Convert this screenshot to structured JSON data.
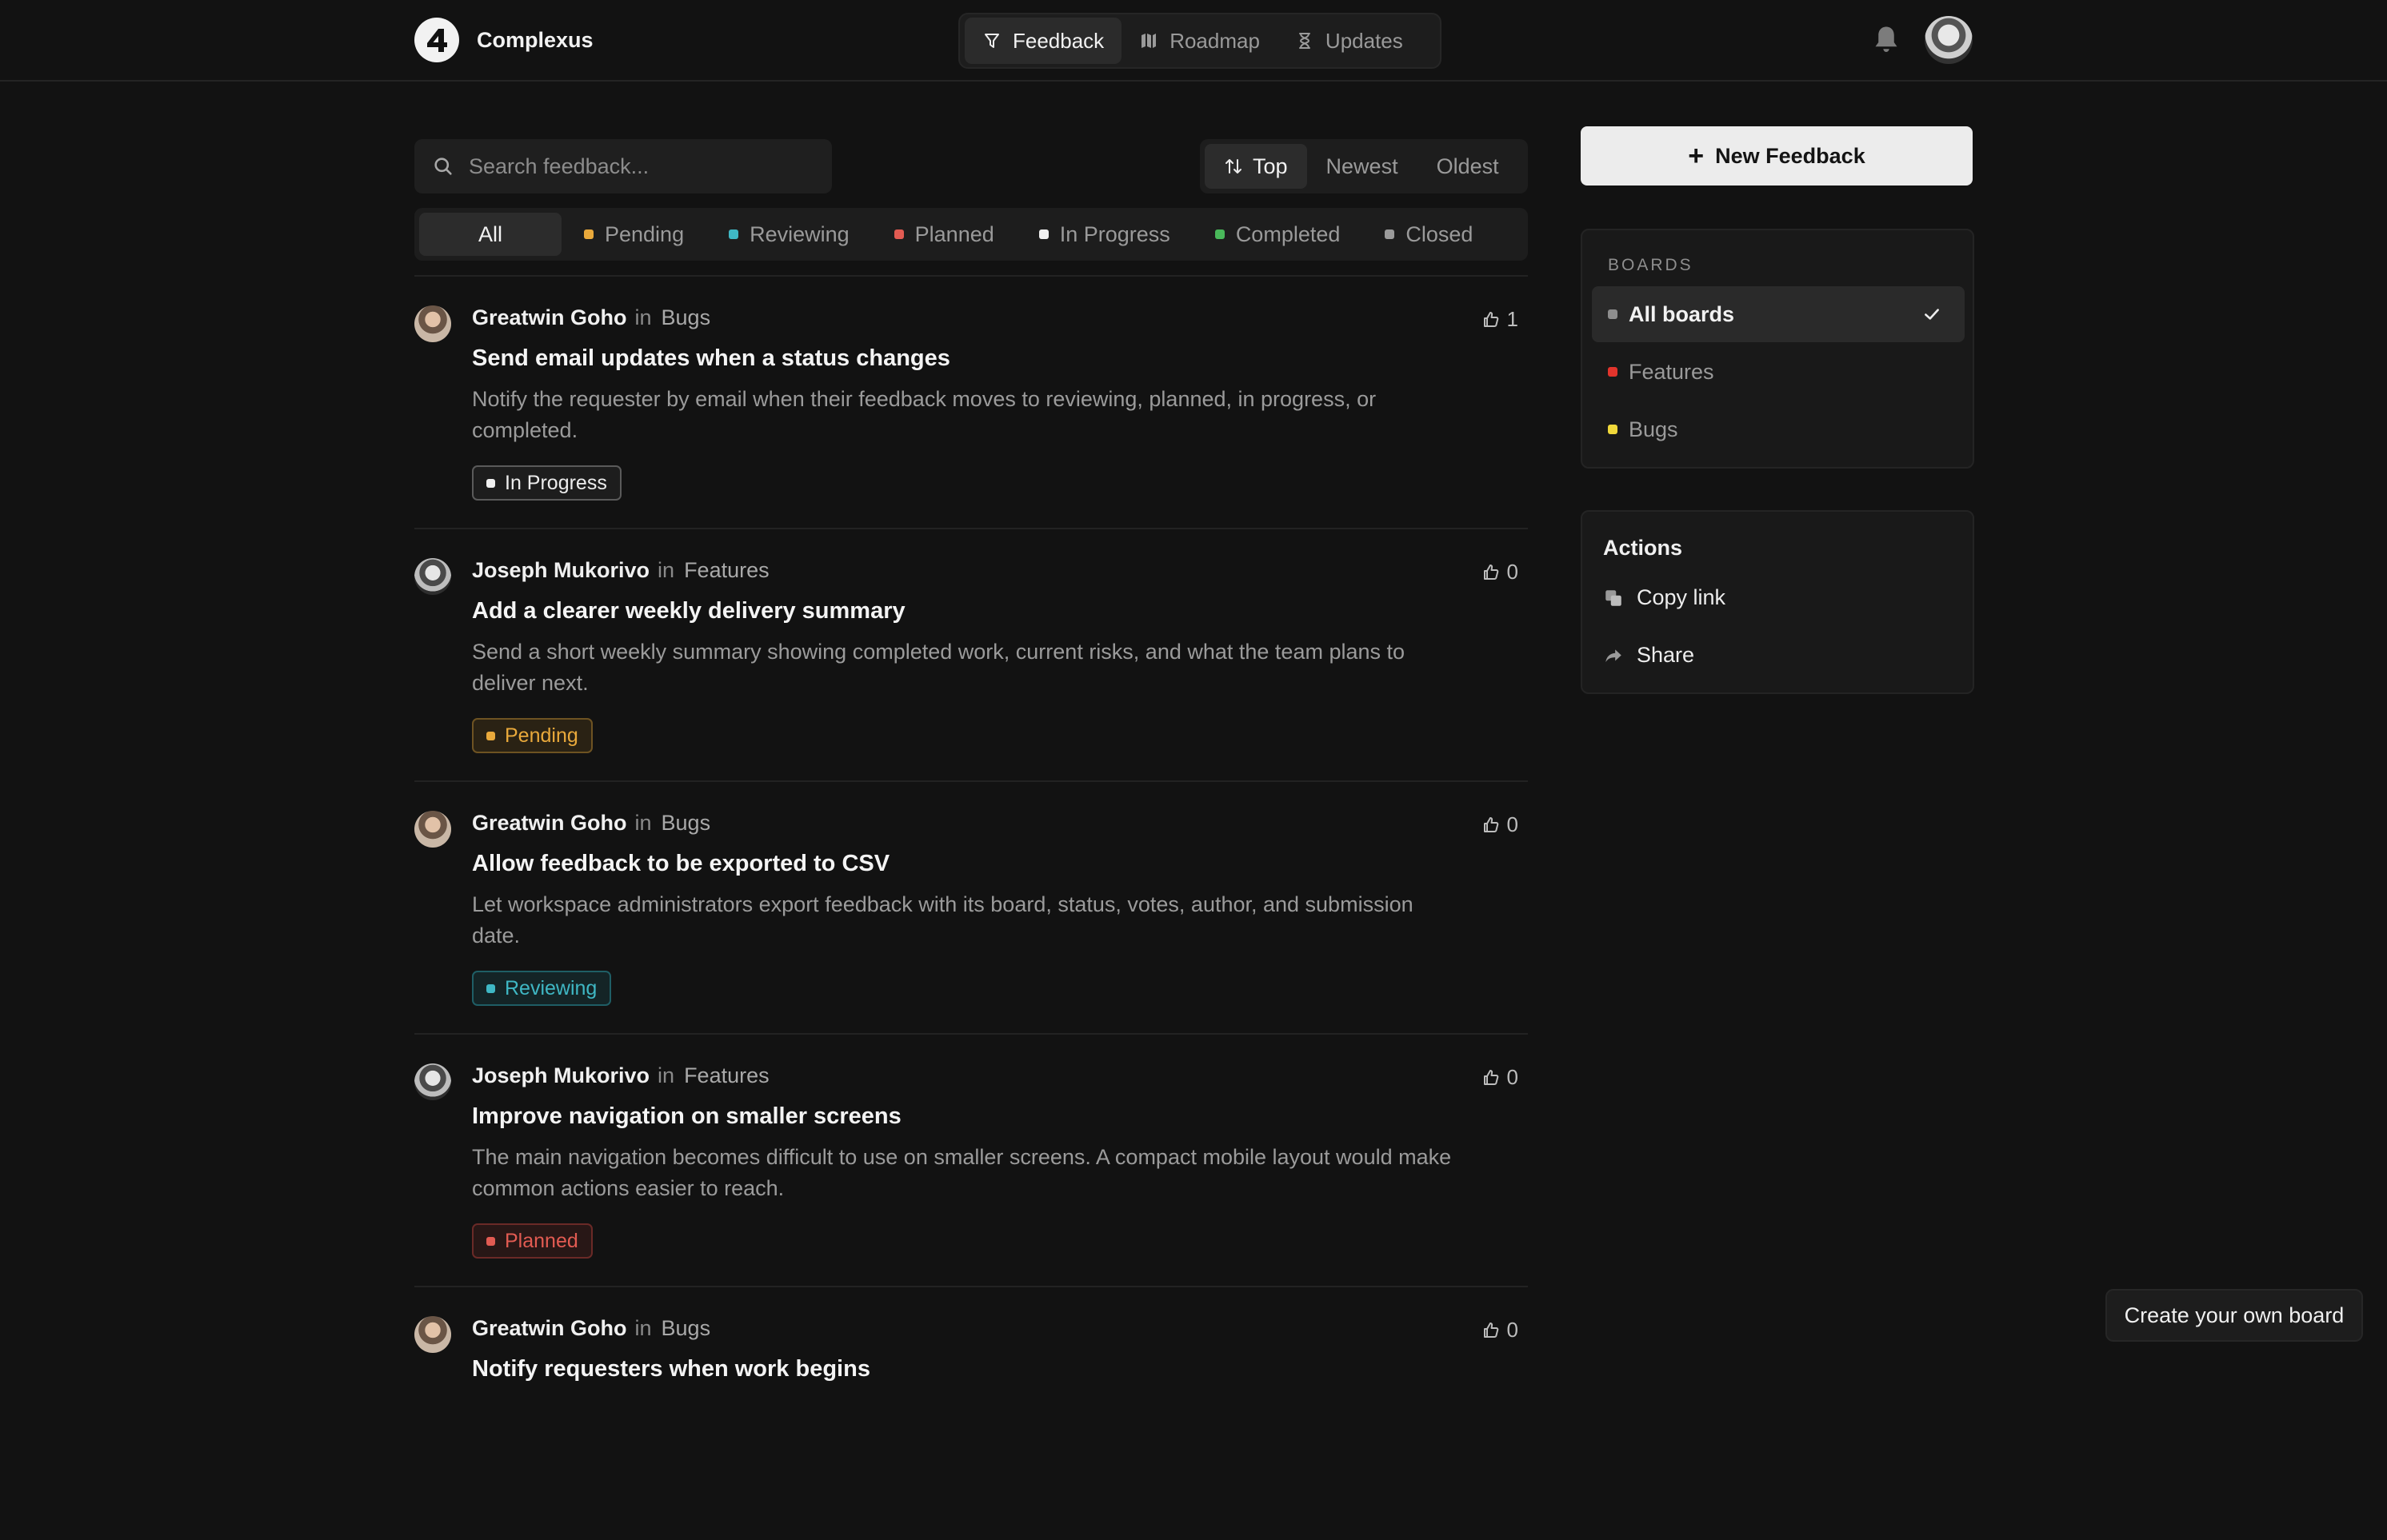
{
  "header": {
    "brand_name": "Complexus",
    "nav": [
      {
        "label": "Feedback",
        "icon": "feedback-icon",
        "active": true
      },
      {
        "label": "Roadmap",
        "icon": "map-icon",
        "active": false
      },
      {
        "label": "Updates",
        "icon": "hourglass-icon",
        "active": false
      }
    ]
  },
  "search": {
    "placeholder": "Search feedback..."
  },
  "sort": {
    "options": [
      "Top",
      "Newest",
      "Oldest"
    ],
    "selected": "Top"
  },
  "filters": [
    {
      "label": "All",
      "color": null,
      "active": true
    },
    {
      "label": "Pending",
      "color": "#e9a93b"
    },
    {
      "label": "Reviewing",
      "color": "#3fb7c4"
    },
    {
      "label": "Planned",
      "color": "#e25b52"
    },
    {
      "label": "In Progress",
      "color": "#f0f0f0"
    },
    {
      "label": "Completed",
      "color": "#49b85a"
    },
    {
      "label": "Closed",
      "color": "#9a9a9a"
    }
  ],
  "feed": [
    {
      "author": "Greatwin Goho",
      "in": "in",
      "board": "Bugs",
      "votes": "1",
      "title": "Send email updates when a status changes",
      "description": "Notify the requester by email when their feedback moves to reviewing, planned, in progress, or completed.",
      "status": "In Progress",
      "status_color": "#f0f0f0",
      "avatar": "greatwin"
    },
    {
      "author": "Joseph Mukorivo",
      "in": "in",
      "board": "Features",
      "votes": "0",
      "title": "Add a clearer weekly delivery summary",
      "description": "Send a short weekly summary showing completed work, current risks, and what the team plans to deliver next.",
      "status": "Pending",
      "status_color": "#e9a93b",
      "avatar": "joseph"
    },
    {
      "author": "Greatwin Goho",
      "in": "in",
      "board": "Bugs",
      "votes": "0",
      "title": "Allow feedback to be exported to CSV",
      "description": "Let workspace administrators export feedback with its board, status, votes, author, and submission date.",
      "status": "Reviewing",
      "status_color": "#3fb7c4",
      "avatar": "greatwin"
    },
    {
      "author": "Joseph Mukorivo",
      "in": "in",
      "board": "Features",
      "votes": "0",
      "title": "Improve navigation on smaller screens",
      "description": "The main navigation becomes difficult to use on smaller screens. A compact mobile layout would make common actions easier to reach.",
      "status": "Planned",
      "status_color": "#e25b52",
      "avatar": "joseph"
    },
    {
      "author": "Greatwin Goho",
      "in": "in",
      "board": "Bugs",
      "votes": "0",
      "title": "Notify requesters when work begins",
      "description": "",
      "status": "",
      "status_color": "",
      "avatar": "greatwin"
    }
  ],
  "sidebar": {
    "new_feedback_label": "New Feedback",
    "boards_title": "BOARDS",
    "boards": [
      {
        "label": "All boards",
        "color": "#8e8e8e",
        "active": true
      },
      {
        "label": "Features",
        "color": "#e2342c",
        "active": false
      },
      {
        "label": "Bugs",
        "color": "#f0d83a",
        "active": false
      }
    ],
    "actions_title": "Actions",
    "actions": [
      {
        "label": "Copy link",
        "icon": "copy-icon"
      },
      {
        "label": "Share",
        "icon": "share-icon"
      }
    ]
  },
  "footer": {
    "create_board_label": "Create your own board"
  }
}
